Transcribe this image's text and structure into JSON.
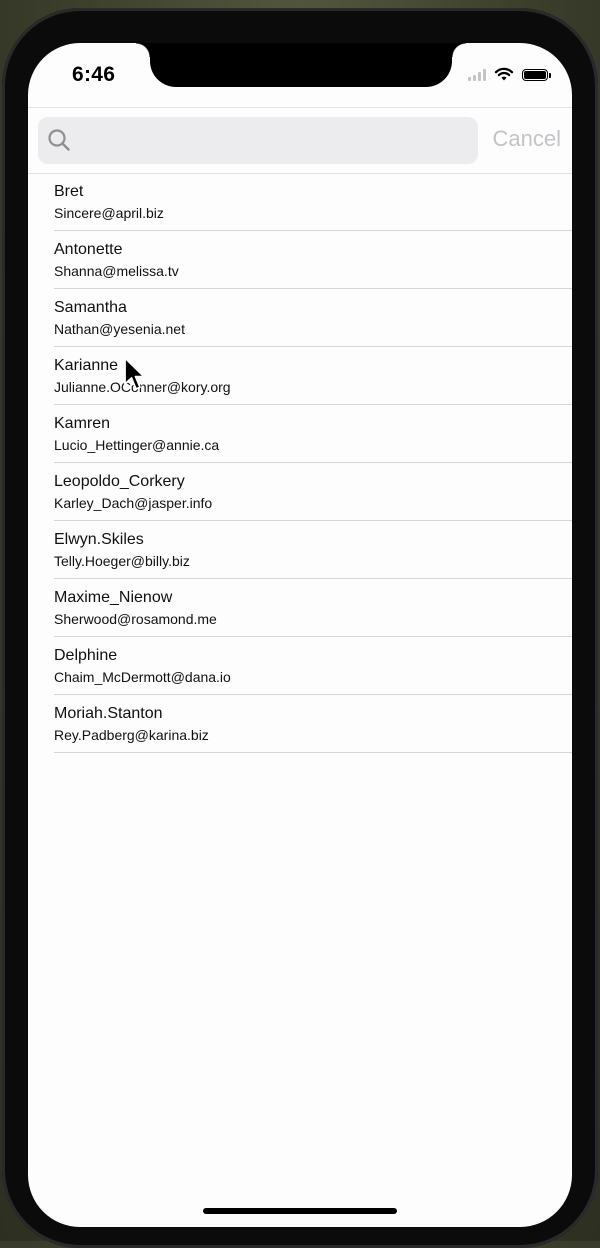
{
  "status_bar": {
    "time": "6:46"
  },
  "search": {
    "placeholder": "",
    "value": "",
    "cancel_label": "Cancel"
  },
  "users": [
    {
      "name": "Bret",
      "email": "Sincere@april.biz"
    },
    {
      "name": "Antonette",
      "email": "Shanna@melissa.tv"
    },
    {
      "name": "Samantha",
      "email": "Nathan@yesenia.net"
    },
    {
      "name": "Karianne",
      "email": "Julianne.OConner@kory.org"
    },
    {
      "name": "Kamren",
      "email": "Lucio_Hettinger@annie.ca"
    },
    {
      "name": "Leopoldo_Corkery",
      "email": "Karley_Dach@jasper.info"
    },
    {
      "name": "Elwyn.Skiles",
      "email": "Telly.Hoeger@billy.biz"
    },
    {
      "name": "Maxime_Nienow",
      "email": "Sherwood@rosamond.me"
    },
    {
      "name": "Delphine",
      "email": "Chaim_McDermott@dana.io"
    },
    {
      "name": "Moriah.Stanton",
      "email": "Rey.Padberg@karina.biz"
    }
  ],
  "colors": {
    "cancel_text": "#c4c4c8",
    "search_field_bg": "#ececee",
    "separator": "#d6d6d8"
  },
  "icons": {
    "search": "search-icon",
    "wifi": "wifi-icon",
    "battery": "battery-icon",
    "signal": "cellular-signal-icon"
  }
}
